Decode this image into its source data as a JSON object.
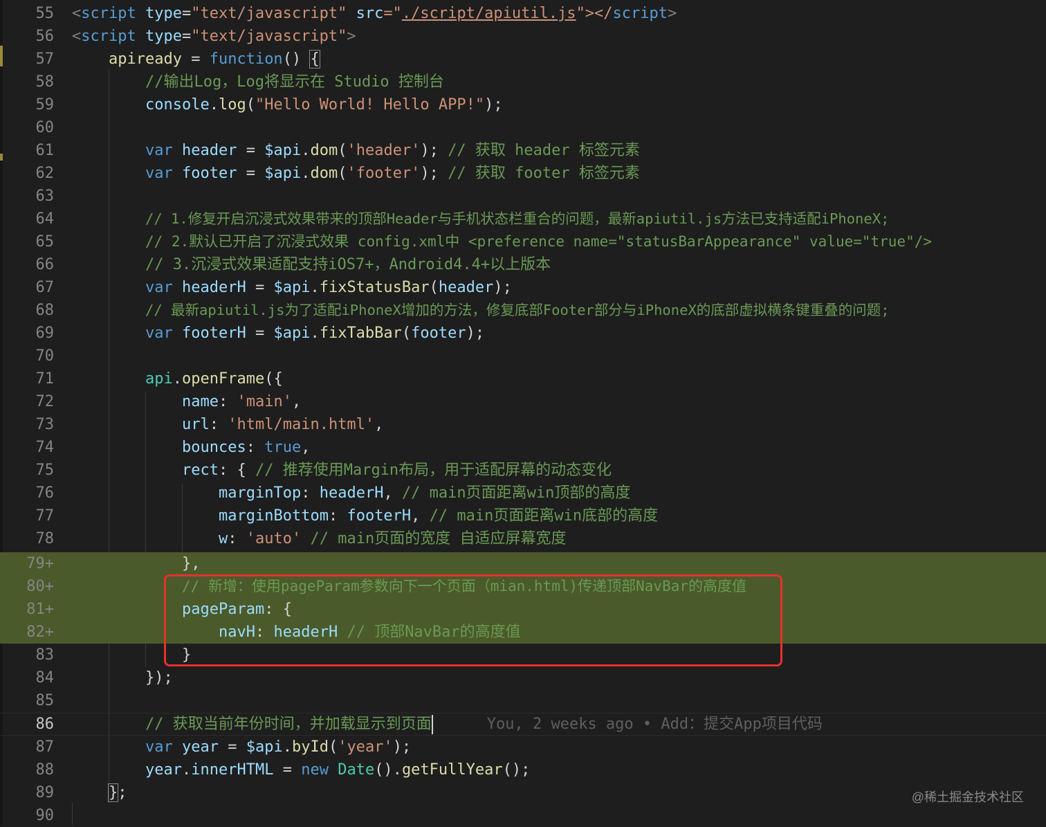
{
  "editor": {
    "lines": [
      {
        "n": "55",
        "added": false
      },
      {
        "n": "56",
        "added": false
      },
      {
        "n": "57",
        "added": false
      },
      {
        "n": "58",
        "added": false
      },
      {
        "n": "59",
        "added": false
      },
      {
        "n": "60",
        "added": false
      },
      {
        "n": "61",
        "added": false
      },
      {
        "n": "62",
        "added": false
      },
      {
        "n": "63",
        "added": false
      },
      {
        "n": "64",
        "added": false
      },
      {
        "n": "65",
        "added": false
      },
      {
        "n": "66",
        "added": false
      },
      {
        "n": "67",
        "added": false
      },
      {
        "n": "68",
        "added": false
      },
      {
        "n": "69",
        "added": false
      },
      {
        "n": "70",
        "added": false
      },
      {
        "n": "71",
        "added": false
      },
      {
        "n": "72",
        "added": false
      },
      {
        "n": "73",
        "added": false
      },
      {
        "n": "74",
        "added": false
      },
      {
        "n": "75",
        "added": false
      },
      {
        "n": "76",
        "added": false
      },
      {
        "n": "77",
        "added": false
      },
      {
        "n": "78",
        "added": false
      },
      {
        "n": "79+",
        "added": true
      },
      {
        "n": "80+",
        "added": true
      },
      {
        "n": "81+",
        "added": true
      },
      {
        "n": "82+",
        "added": true
      },
      {
        "n": "83",
        "added": false
      },
      {
        "n": "84",
        "added": false
      },
      {
        "n": "85",
        "added": false
      },
      {
        "n": "86",
        "added": false,
        "current": true
      },
      {
        "n": "87",
        "added": false
      },
      {
        "n": "88",
        "added": false
      },
      {
        "n": "89",
        "added": false
      },
      {
        "n": "90",
        "added": false
      }
    ],
    "tokens": {
      "l55": [
        "<",
        "script",
        " ",
        "type",
        "=",
        "\"text/javascript\"",
        " ",
        "src",
        "=\"",
        "./script/apiutil.js",
        "\"></",
        "script",
        ">"
      ],
      "l56": [
        "<",
        "script",
        " ",
        "type",
        "=",
        "\"text/javascript\"",
        ">"
      ],
      "l57": [
        "apiready",
        " = ",
        "function",
        "() ",
        "{"
      ],
      "l58": [
        "//输出Log，Log将显示在 Studio 控制台"
      ],
      "l59": [
        "console",
        ".",
        "log",
        "(",
        "\"Hello World! Hello APP!\"",
        ");"
      ],
      "l61": [
        "var",
        " ",
        "header",
        " = ",
        "$api",
        ".",
        "dom",
        "(",
        "'header'",
        ");",
        " ",
        "// 获取 header 标签元素"
      ],
      "l62": [
        "var",
        " ",
        "footer",
        " = ",
        "$api",
        ".",
        "dom",
        "(",
        "'footer'",
        ");",
        " ",
        "// 获取 footer 标签元素"
      ],
      "l64": [
        "// 1.修复开启沉浸式效果带来的顶部Header与手机状态栏重合的问题，最新apiutil.js方法已支持适配iPhoneX;"
      ],
      "l65": [
        "// 2.默认已开启了沉浸式效果 config.xml中 <preference name=\"statusBarAppearance\" value=\"true\"/>"
      ],
      "l66": [
        "// 3.沉浸式效果适配支持iOS7+，Android4.4+以上版本"
      ],
      "l67": [
        "var",
        " ",
        "headerH",
        " = ",
        "$api",
        ".",
        "fixStatusBar",
        "(",
        "header",
        ");"
      ],
      "l68": [
        "// 最新apiutil.js为了适配iPhoneX增加的方法，修复底部Footer部分与iPhoneX的底部虚拟横条键重叠的问题;"
      ],
      "l69": [
        "var",
        " ",
        "footerH",
        " = ",
        "$api",
        ".",
        "fixTabBar",
        "(",
        "footer",
        ");"
      ],
      "l71": [
        "api",
        ".",
        "openFrame",
        "({"
      ],
      "l72": [
        "name",
        ": ",
        "'main'",
        ","
      ],
      "l73": [
        "url",
        ": ",
        "'html/main.html'",
        ","
      ],
      "l74": [
        "bounces",
        ": ",
        "true",
        ","
      ],
      "l75": [
        "rect",
        ": { ",
        "// 推荐使用Margin布局，用于适配屏幕的动态变化"
      ],
      "l76": [
        "marginTop",
        ": ",
        "headerH",
        ", ",
        "// main页面距离win顶部的高度"
      ],
      "l77": [
        "marginBottom",
        ": ",
        "footerH",
        ", ",
        "// main页面距离win底部的高度"
      ],
      "l78": [
        "w",
        ": ",
        "'auto'",
        " ",
        "// main页面的宽度 自适应屏幕宽度"
      ],
      "l79": [
        "},"
      ],
      "l80": [
        "// 新增：使用pageParam参数向下一个页面（mian.html)传递顶部NavBar的高度值"
      ],
      "l81": [
        "pageParam",
        ": {"
      ],
      "l82": [
        "navH",
        ": ",
        "headerH",
        " ",
        "// 顶部NavBar的高度值"
      ],
      "l83": [
        "}"
      ],
      "l84": [
        "});"
      ],
      "l86": [
        "// 获取当前年份时间，并加载显示到页面"
      ],
      "l87": [
        "var",
        " ",
        "year",
        " = ",
        "$api",
        ".",
        "byId",
        "(",
        "'year'",
        ");"
      ],
      "l88": [
        "year",
        ".",
        "innerHTML",
        " = ",
        "new",
        " ",
        "Date",
        "().",
        "getFullYear",
        "();"
      ],
      "l89": [
        "}",
        ";"
      ]
    },
    "blame": "You, 2 weeks ago • Add：提交App项目代码"
  },
  "colors": {
    "background": "#1e1e1e",
    "added_line": "#4b5a2a",
    "highlight_box": "#e8302c",
    "keyword": "#569cd6",
    "string": "#ce9178",
    "comment": "#6a9955",
    "variable": "#9cdcfe",
    "function": "#dcdcaa"
  },
  "watermark": "@稀土掘金技术社区"
}
